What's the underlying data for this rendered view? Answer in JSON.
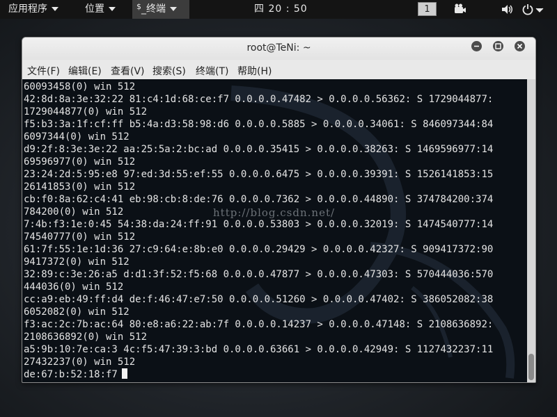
{
  "top_panel": {
    "applications": "应用程序",
    "places": "位置",
    "terminal_prompt": "$",
    "terminal_label": "_终端",
    "clock": "四 20 : 50",
    "workspace": "1",
    "camera_icon": "camera-icon",
    "volume_icon": "volume-icon",
    "power_icon": "power-icon"
  },
  "window": {
    "title": "root@TeNi: ~",
    "menu": {
      "file": "文件(F)",
      "edit": "编辑(E)",
      "view": "查看(V)",
      "search": "搜索(S)",
      "terminal": "终端(T)",
      "help": "帮助(H)"
    }
  },
  "terminal": {
    "watermark": "http://blog.csdn.net/",
    "lines": [
      "60093458(0) win 512",
      "42:8d:8a:3e:32:22 81:c4:1d:68:ce:f7 0.0.0.0.47482 > 0.0.0.0.56362: S 1729044877:",
      "1729044877(0) win 512",
      "f5:b3:3a:1f:cf:ff b5:4a:d3:58:98:d6 0.0.0.0.5885 > 0.0.0.0.34061: S 846097344:84",
      "6097344(0) win 512",
      "d9:2f:8:3e:3e:22 aa:25:5a:2:bc:ad 0.0.0.0.35415 > 0.0.0.0.38263: S 1469596977:14",
      "69596977(0) win 512",
      "23:24:2d:5:95:e8 97:ed:3d:55:ef:55 0.0.0.0.6475 > 0.0.0.0.39391: S 1526141853:15",
      "26141853(0) win 512",
      "cb:f0:8a:62:c4:41 eb:98:cb:8:de:76 0.0.0.0.7362 > 0.0.0.0.44890: S 374784200:374",
      "784200(0) win 512",
      "7:4b:f3:1e:0:45 54:38:da:24:ff:91 0.0.0.0.53803 > 0.0.0.0.32019: S 1474540777:14",
      "74540777(0) win 512",
      "61:7f:55:1e:1d:36 27:c9:64:e:8b:e0 0.0.0.0.29429 > 0.0.0.0.42327: S 909417372:90",
      "9417372(0) win 512",
      "32:89:c:3e:26:a5 d:d1:3f:52:f5:68 0.0.0.0.47877 > 0.0.0.0.47303: S 570444036:570",
      "444036(0) win 512",
      "cc:a9:eb:49:ff:d4 de:f:46:47:e7:50 0.0.0.0.51260 > 0.0.0.0.47402: S 386052082:38",
      "6052082(0) win 512",
      "f3:ac:2c:7b:ac:64 80:e8:a6:22:ab:7f 0.0.0.0.14237 > 0.0.0.0.47148: S 2108636892:",
      "2108636892(0) win 512",
      "a5:9b:10:7e:ca:3 4c:f5:47:39:3:bd 0.0.0.0.63661 > 0.0.0.0.42949: S 1127432237:11",
      "27432237(0) win 512"
    ],
    "last_line": "de:67:b:52:18:f7"
  }
}
